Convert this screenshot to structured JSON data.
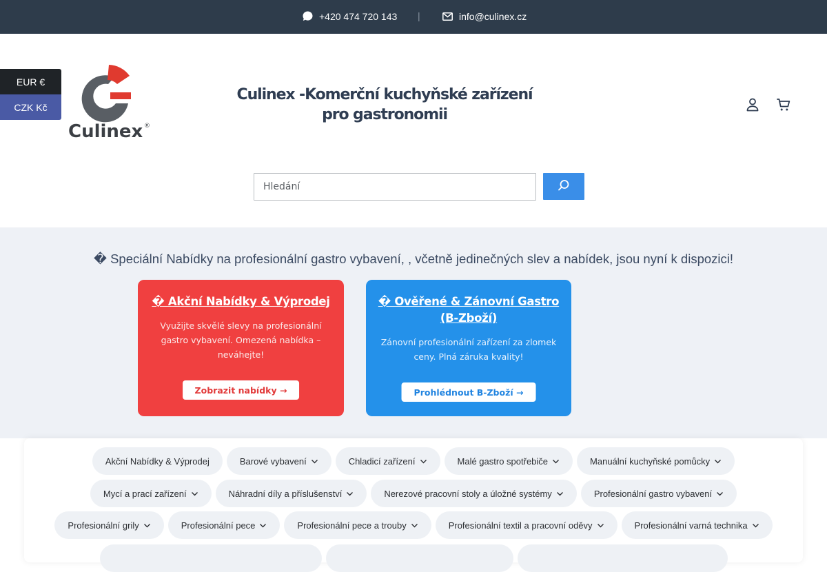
{
  "topbar": {
    "phone": "+420 474 720 143",
    "separator": "|",
    "email": "info@culinex.cz",
    "phone_icon": "chat-bubble-icon",
    "email_icon": "envelope-icon"
  },
  "currency": {
    "options": [
      "EUR €",
      "CZK Kč"
    ],
    "selected": "EUR €"
  },
  "header": {
    "logo_text": "Culinex",
    "logo_mark": "®",
    "title": "Culinex -Komerční kuchyňské zařízení pro gastronomii",
    "icons": [
      "user-icon",
      "cart-icon"
    ]
  },
  "search": {
    "placeholder": "Hledání",
    "button_icon": "search-icon"
  },
  "promo": {
    "heading": "� Speciální Nabídky na profesionální gastro vybavení, , včetně jedinečných slev a nabídek, jsou nyní k dispozici!",
    "cards": [
      {
        "title": "� Akční Nabídky & Výprodej",
        "text": "Využijte skvělé slevy na profesionální gastro vybavení. Omezená nabídka – neváhejte!",
        "button": "Zobrazit nabídky →",
        "color": "#f04040"
      },
      {
        "title": "� Ověřené & Zánovní Gastro (B-Zboží)",
        "text": "Zánovní profesionální zařízení za zlomek ceny. Plná záruka kvality!",
        "button": "Prohlédnout B-Zboží →",
        "color": "#2491ea"
      }
    ]
  },
  "categories": {
    "rows": [
      [
        {
          "label": "Akční Nabídky & Výprodej",
          "dropdown": false
        },
        {
          "label": "Barové vybavení",
          "dropdown": true
        },
        {
          "label": "Chladicí zařízení",
          "dropdown": true
        },
        {
          "label": "Malé gastro spotřebiče",
          "dropdown": true
        },
        {
          "label": "Manuální kuchyňské pomůcky",
          "dropdown": true
        }
      ],
      [
        {
          "label": "Mycí a prací zařízení",
          "dropdown": true
        },
        {
          "label": "Náhradní díly a příslušenství",
          "dropdown": true
        },
        {
          "label": "Nerezové pracovní stoly a úložné systémy",
          "dropdown": true
        },
        {
          "label": "Profesionální gastro vybavení",
          "dropdown": true
        }
      ],
      [
        {
          "label": "Profesionální grily",
          "dropdown": true
        },
        {
          "label": "Profesionální pece",
          "dropdown": true
        },
        {
          "label": "Profesionální pece a trouby",
          "dropdown": true
        },
        {
          "label": "Profesionální textil a pracovní oděvy",
          "dropdown": true
        },
        {
          "label": "Profesionální varná technika",
          "dropdown": true
        }
      ]
    ],
    "chevron_icon": "chevron-down-icon"
  },
  "colors": {
    "topbar": "#2e3c4b",
    "title": "#2f3d52",
    "accent": "#3a8ee8",
    "logo_red": "#e03a2f",
    "logo_gray": "#555a60"
  }
}
